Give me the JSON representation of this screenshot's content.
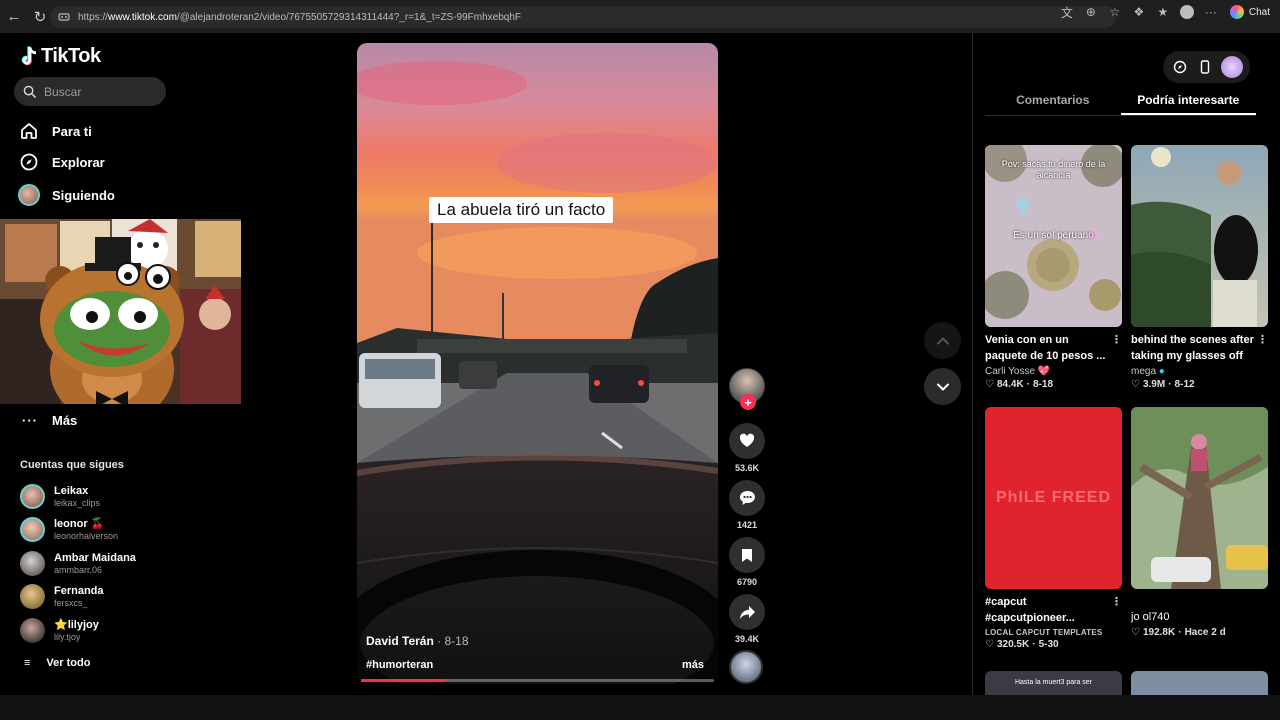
{
  "browser": {
    "url_prefix": "https://",
    "url_domain": "www.tiktok.com",
    "url_rest": "/@alejandroteran2/video/7675505729314311444?_r=1&_t=ZS-99FmhxebqhF",
    "chat_label": "Chat"
  },
  "sidebar": {
    "logo": "TikTok",
    "search_placeholder": "Buscar",
    "nav": [
      {
        "label": "Para ti",
        "icon": "home-icon"
      },
      {
        "label": "Explorar",
        "icon": "compass-icon"
      },
      {
        "label": "Siguiendo",
        "icon": "avatar"
      }
    ],
    "more_label": "Más",
    "following_title": "Cuentas que sigues",
    "accounts": [
      {
        "name": "Leikax",
        "handle": "leikax_clips"
      },
      {
        "name": "leonor 🍒",
        "handle": "leonorhalverson"
      },
      {
        "name": "Ambar Maidana",
        "handle": "ammbarr.06"
      },
      {
        "name": "Fernanda",
        "handle": "fersxcs_"
      },
      {
        "name": "⭐lilyjoy",
        "handle": "lily.tjoy"
      }
    ],
    "see_all": "Ver todo"
  },
  "video": {
    "caption": "La abuela tiró un facto",
    "author": "David Terán",
    "date": " · 8-18",
    "hashtag": "#humorteran",
    "more": "más",
    "progress": 0.24
  },
  "actions": {
    "likes": "53.6K",
    "comments": "1421",
    "saves": "6790",
    "shares": "39.4K"
  },
  "right_panel": {
    "tabs": [
      "Comentarios",
      "Podría interesarte"
    ],
    "active_tab": 1,
    "cards": [
      {
        "overlay_top": "Pov: sacas tu dinero de la alcancía",
        "overlay_mid": "Es un sol peruano",
        "title": "Venia con en un paquete de 10 pesos ...",
        "author": "Carli Yosse 💖",
        "likes": "84.4K",
        "date": "8-18"
      },
      {
        "title": "behind the scenes after taking my glasses off",
        "author": "mega",
        "verified": true,
        "likes": "3.9M",
        "date": "8-12"
      },
      {
        "overlay_mid": "PhILE FREED",
        "title": "#capcut #capcutpioneer...",
        "sub": "LOCAL CAPCUT TEMPLATES",
        "likes": "320.5K",
        "date": "5-30"
      },
      {
        "title": "jo ol740",
        "likes": "192.8K",
        "date": "Hace 2 d"
      },
      {
        "overlay_top": "Hasta la muert3 para ser"
      }
    ]
  }
}
